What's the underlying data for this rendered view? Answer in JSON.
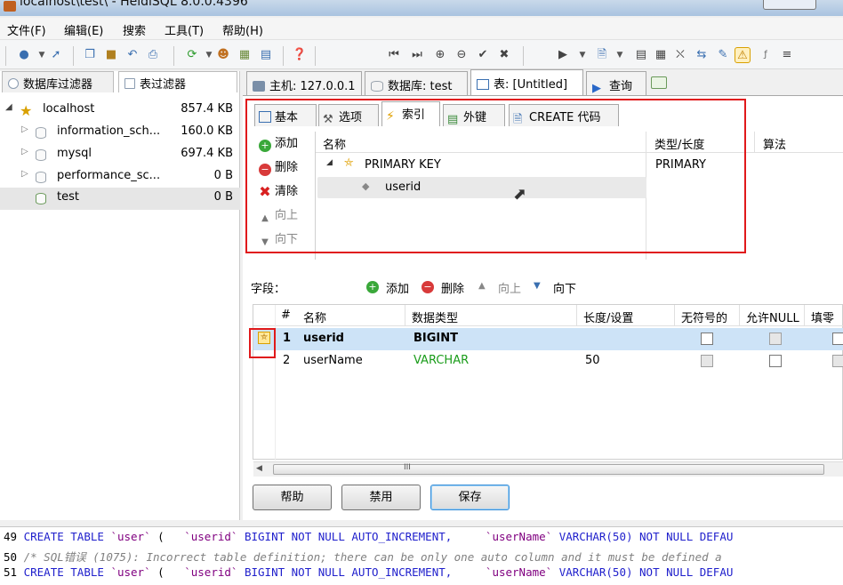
{
  "window": {
    "title": "localhost\\test\\ - HeidiSQL 8.0.0.4396"
  },
  "menu": [
    "文件(F)",
    "编辑(E)",
    "搜索",
    "工具(T)",
    "帮助(H)"
  ],
  "left_tabs": [
    "数据库过滤器",
    "表过滤器"
  ],
  "tree": [
    {
      "name": "localhost",
      "size": "857.4 KB"
    },
    {
      "name": "information_sch...",
      "size": "160.0 KB"
    },
    {
      "name": "mysql",
      "size": "697.4 KB"
    },
    {
      "name": "performance_sc...",
      "size": "0 B"
    },
    {
      "name": "test",
      "size": "0 B"
    }
  ],
  "main_tabs": [
    "主机: 127.0.0.1",
    "数据库: test",
    "表: [Untitled]",
    "查询"
  ],
  "sub_tabs": [
    "基本",
    "选项",
    "索引",
    "外键",
    "CREATE 代码"
  ],
  "index_buttons": {
    "add": "添加",
    "remove": "删除",
    "clear": "清除",
    "up": "向上",
    "down": "向下"
  },
  "index_grid": {
    "headers": [
      "名称",
      "类型/长度",
      "算法"
    ],
    "rows": [
      {
        "name": "PRIMARY KEY",
        "type": "PRIMARY"
      },
      {
        "name": "userid",
        "type": ""
      }
    ]
  },
  "fields": {
    "label": "字段：",
    "toolbar": {
      "add": "添加",
      "remove": "删除",
      "up": "向上",
      "down": "向下"
    },
    "headers": [
      "#",
      "名称",
      "数据类型",
      "长度/设置",
      "无符号的",
      "允许NULL",
      "填零"
    ],
    "rows": [
      {
        "num": "1",
        "name": "userid",
        "type": "BIGINT",
        "length": ""
      },
      {
        "num": "2",
        "name": "userName",
        "type": "VARCHAR",
        "length": "50"
      }
    ],
    "scroll_glyph": "III"
  },
  "buttons": {
    "help": "帮助",
    "disable": "禁用",
    "save": "保存"
  },
  "log": [
    {
      "n": "49",
      "kw1": "CREATE TABLE",
      "s1": "`user`",
      "t1": " (   ",
      "s2": "`userid`",
      "kw2": " BIGINT NOT NULL AUTO_INCREMENT,",
      "t2": "     ",
      "s3": "`userName`",
      "kw3": " VARCHAR(50) NOT NULL DEFAU"
    },
    {
      "n": "50",
      "comment": "/* SQL错误 (1075): Incorrect table definition; there can be only one auto column and it must be defined a"
    },
    {
      "n": "51",
      "kw1": "CREATE TABLE",
      "s1": "`user`",
      "t1": " (   ",
      "s2": "`userid`",
      "kw2": " BIGINT NOT NULL AUTO_INCREMENT,",
      "t2": "     ",
      "s3": "`userName`",
      "kw3": " VARCHAR(50) NOT NULL DEFAU"
    }
  ],
  "colors": {
    "accent": "#3a6fb0",
    "highlight": "#cde3f7",
    "varchar_green": "#1a9c1a",
    "red_box": "#e0191b"
  }
}
